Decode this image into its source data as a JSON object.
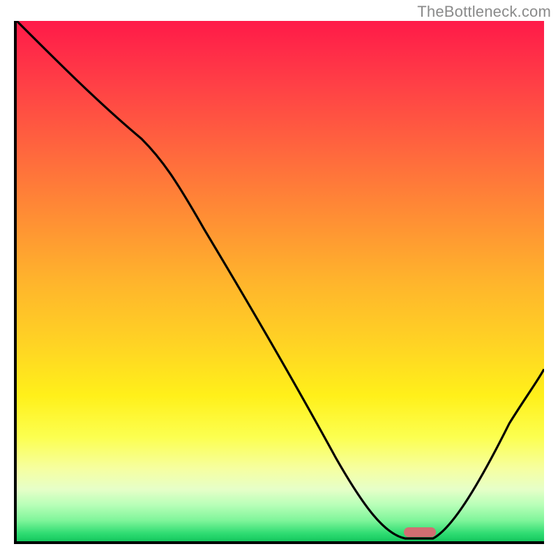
{
  "watermark": "TheBottleneck.com",
  "chart_data": {
    "type": "line",
    "title": "",
    "xlabel": "",
    "ylabel": "",
    "xlim": [
      0,
      100
    ],
    "ylim": [
      0,
      100
    ],
    "x": [
      0,
      12,
      25,
      40,
      55,
      63,
      70,
      74,
      78,
      82,
      88,
      95,
      100
    ],
    "values": [
      100,
      90,
      79,
      58,
      36,
      24,
      10,
      2,
      0,
      0,
      8,
      22,
      33
    ],
    "annotations": [
      {
        "type": "marker",
        "shape": "pill",
        "x": 77,
        "y": 1.5,
        "color": "#d26e72"
      }
    ],
    "background": "vertical-gradient red→orange→yellow→green",
    "grid": false
  }
}
